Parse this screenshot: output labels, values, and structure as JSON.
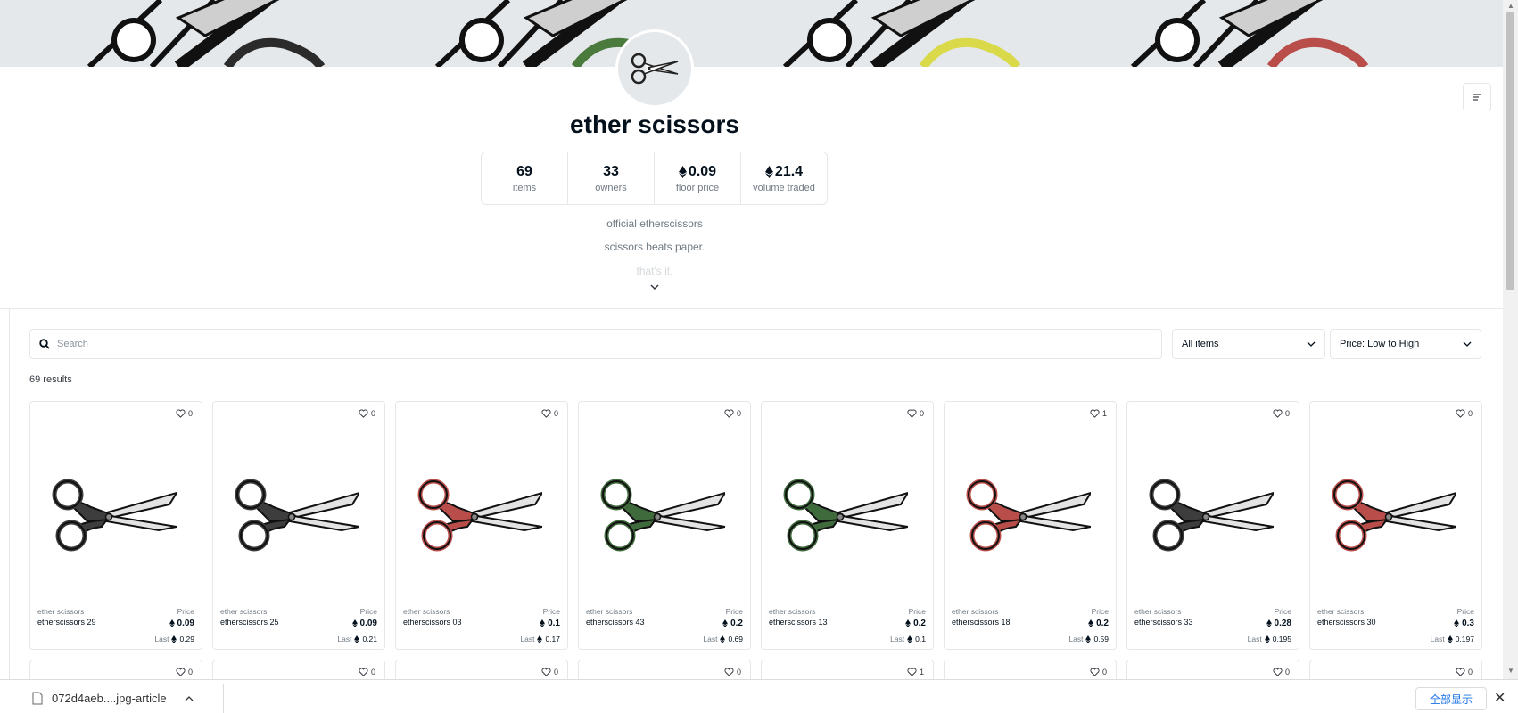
{
  "collection": {
    "title": "ether scissors",
    "stats": [
      {
        "value": "69",
        "label": "items",
        "eth": false
      },
      {
        "value": "33",
        "label": "owners",
        "eth": false
      },
      {
        "value": "0.09",
        "label": "floor price",
        "eth": true
      },
      {
        "value": "21.4",
        "label": "volume traded",
        "eth": true
      }
    ],
    "description": [
      "official etherscissors",
      "scissors beats paper.",
      "that's it."
    ]
  },
  "search": {
    "placeholder": "Search"
  },
  "filters": {
    "items": "All items",
    "sort": "Price: Low to High"
  },
  "results_count": "69 results",
  "labels": {
    "price": "Price",
    "last": "Last"
  },
  "cards": [
    {
      "collection": "ether scissors",
      "name": "etherscissors 29",
      "price": "0.09",
      "last": "0.29",
      "favorites": "0",
      "color": "#3d3d3d"
    },
    {
      "collection": "ether scissors",
      "name": "etherscissors 25",
      "price": "0.09",
      "last": "0.21",
      "favorites": "0",
      "color": "#3d3d3d"
    },
    {
      "collection": "ether scissors",
      "name": "etherscissors 03",
      "price": "0.1",
      "last": "0.17",
      "favorites": "0",
      "color": "#b84d4a"
    },
    {
      "collection": "ether scissors",
      "name": "etherscissors 43",
      "price": "0.2",
      "last": "0.69",
      "favorites": "0",
      "color": "#3f6a3c"
    },
    {
      "collection": "ether scissors",
      "name": "etherscissors 13",
      "price": "0.2",
      "last": "0.1",
      "favorites": "0",
      "color": "#3f6a3c"
    },
    {
      "collection": "ether scissors",
      "name": "etherscissors 18",
      "price": "0.2",
      "last": "0.59",
      "favorites": "1",
      "color": "#b84d4a"
    },
    {
      "collection": "ether scissors",
      "name": "etherscissors 33",
      "price": "0.28",
      "last": "0.195",
      "favorites": "0",
      "color": "#3d3d3d"
    },
    {
      "collection": "ether scissors",
      "name": "etherscissors 30",
      "price": "0.3",
      "last": "0.197",
      "favorites": "0",
      "color": "#b84d4a"
    }
  ],
  "row2_favorites": [
    "0",
    "0",
    "0",
    "0",
    "1",
    "0",
    "0",
    "0"
  ],
  "download": {
    "filename": "072d4aeb....jpg-article",
    "show_all": "全部显示"
  },
  "icons": {
    "eth": "ethereum-icon",
    "heart": "heart-icon",
    "search": "search-icon",
    "chevron": "chevron-down-icon",
    "menu": "menu-icon",
    "file": "file-icon",
    "close": "close-icon"
  }
}
